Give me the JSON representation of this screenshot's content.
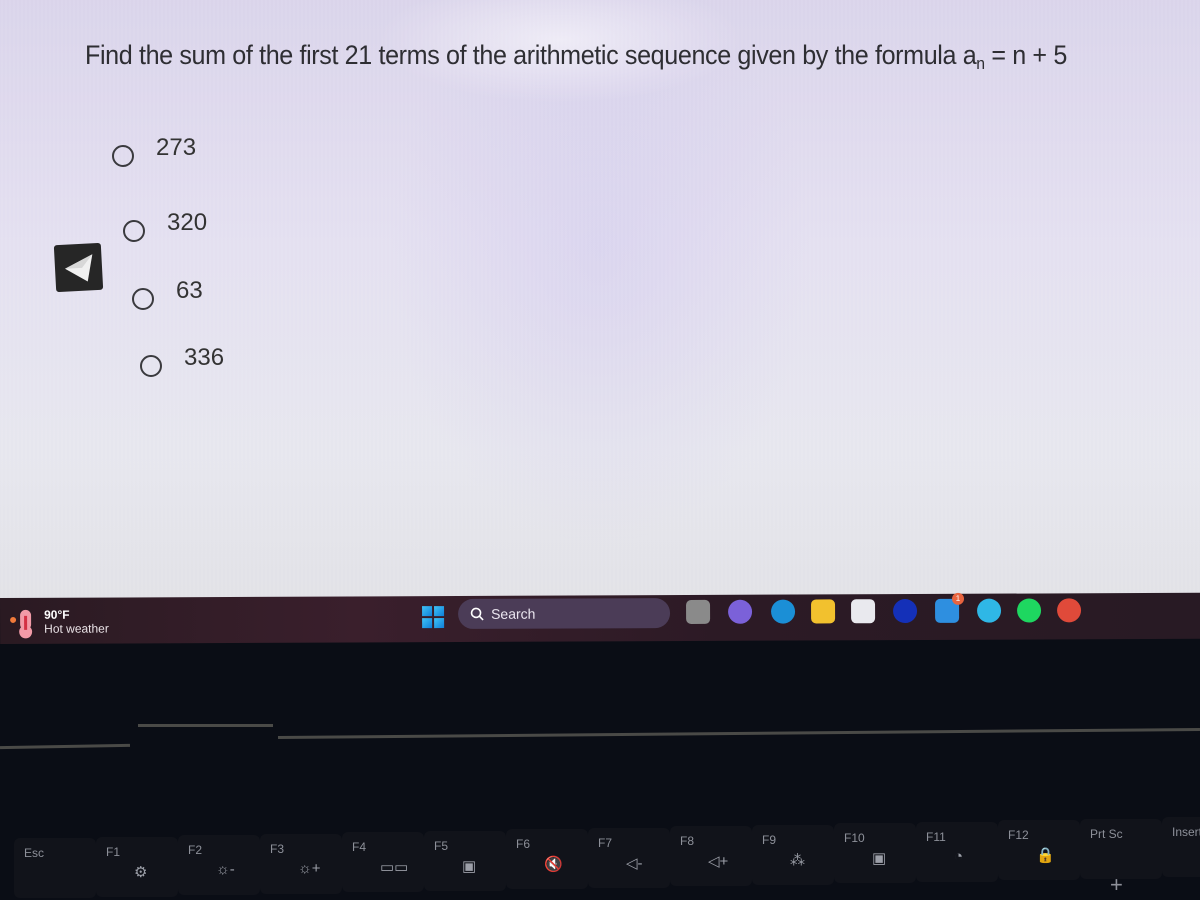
{
  "question": {
    "prefix": "Find the sum of the first 21 terms of the arithmetic sequence given by the formula a",
    "subscript": "n",
    "suffix": " = n + 5"
  },
  "options": [
    {
      "label": "273",
      "selected": false
    },
    {
      "label": "320",
      "selected": false
    },
    {
      "label": "63",
      "selected": false
    },
    {
      "label": "336",
      "selected": false
    }
  ],
  "back_button": {
    "icon": "arrow-left-icon"
  },
  "taskbar": {
    "weather": {
      "temp": "90°F",
      "condition": "Hot weather",
      "icon": "thermometer-hot-icon"
    },
    "start_icon": "windows-logo-icon",
    "search_label": "Search",
    "apps": [
      {
        "name": "task-view",
        "color": "#8a8a8a"
      },
      {
        "name": "meet",
        "color": "#7b61d9"
      },
      {
        "name": "edge",
        "color": "#1b8fd6"
      },
      {
        "name": "file-explorer",
        "color": "#f2c12e"
      },
      {
        "name": "store",
        "color": "#e9e9ee"
      },
      {
        "name": "quick-assist",
        "color": "#1430b8"
      },
      {
        "name": "mail",
        "color": "#2e8fe0",
        "badge": "1"
      },
      {
        "name": "alexa",
        "color": "#2fb7e6"
      },
      {
        "name": "spotify",
        "color": "#1ed760"
      },
      {
        "name": "chrome",
        "color": "#e04a3a"
      }
    ]
  },
  "keyboard": {
    "keys": [
      {
        "label": "Esc",
        "icon": ""
      },
      {
        "label": "F1",
        "icon": "⚙"
      },
      {
        "label": "F2",
        "icon": "☼-"
      },
      {
        "label": "F3",
        "icon": "☼+"
      },
      {
        "label": "F4",
        "icon": "▭▭"
      },
      {
        "label": "F5",
        "icon": "▣"
      },
      {
        "label": "F6",
        "icon": "🔇"
      },
      {
        "label": "F7",
        "icon": "◁-"
      },
      {
        "label": "F8",
        "icon": "◁+"
      },
      {
        "label": "F9",
        "icon": "⁂"
      },
      {
        "label": "F10",
        "icon": "▣"
      },
      {
        "label": "F11",
        "icon": "◔"
      },
      {
        "label": "F12",
        "icon": "🔒"
      },
      {
        "label": "Prt Sc",
        "icon": ""
      },
      {
        "label": "Insert",
        "icon": ""
      }
    ],
    "plus_key": "+"
  }
}
